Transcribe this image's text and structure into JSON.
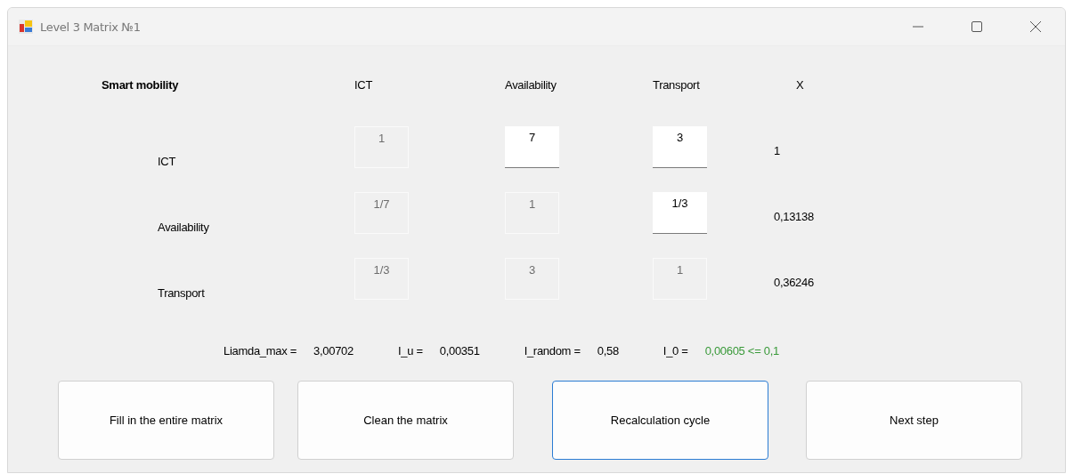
{
  "window": {
    "title": "Level 3 Matrix №1"
  },
  "matrix": {
    "corner_label": "Smart mobility",
    "columns": [
      "ICT",
      "Availability",
      "Transport",
      "X"
    ],
    "rows": [
      {
        "label": "ICT",
        "cells": [
          {
            "value": "1",
            "disabled": true
          },
          {
            "value": "7",
            "disabled": false
          },
          {
            "value": "3",
            "disabled": false
          }
        ],
        "x_value": "1"
      },
      {
        "label": "Availability",
        "cells": [
          {
            "value": "1/7",
            "disabled": true
          },
          {
            "value": "1",
            "disabled": true
          },
          {
            "value": "1/3",
            "disabled": false
          }
        ],
        "x_value": "0,13138"
      },
      {
        "label": "Transport",
        "cells": [
          {
            "value": "1/3",
            "disabled": true
          },
          {
            "value": "3",
            "disabled": true
          },
          {
            "value": "1",
            "disabled": true
          }
        ],
        "x_value": "0,36246"
      }
    ]
  },
  "stats": [
    {
      "label": "Liamda_max =",
      "value": "3,00702",
      "highlighted": false
    },
    {
      "label": "I_u =",
      "value": "0,00351",
      "highlighted": false
    },
    {
      "label": "I_random =",
      "value": "0,58",
      "highlighted": false
    },
    {
      "label": "I_0 =",
      "value": "0,00605 <= 0,1",
      "highlighted": true
    }
  ],
  "buttons": [
    {
      "label": "Fill in the entire matrix",
      "focused": false
    },
    {
      "label": "Clean the matrix",
      "focused": false
    },
    {
      "label": "Recalculation cycle",
      "focused": true
    },
    {
      "label": "Next step",
      "focused": false
    }
  ]
}
